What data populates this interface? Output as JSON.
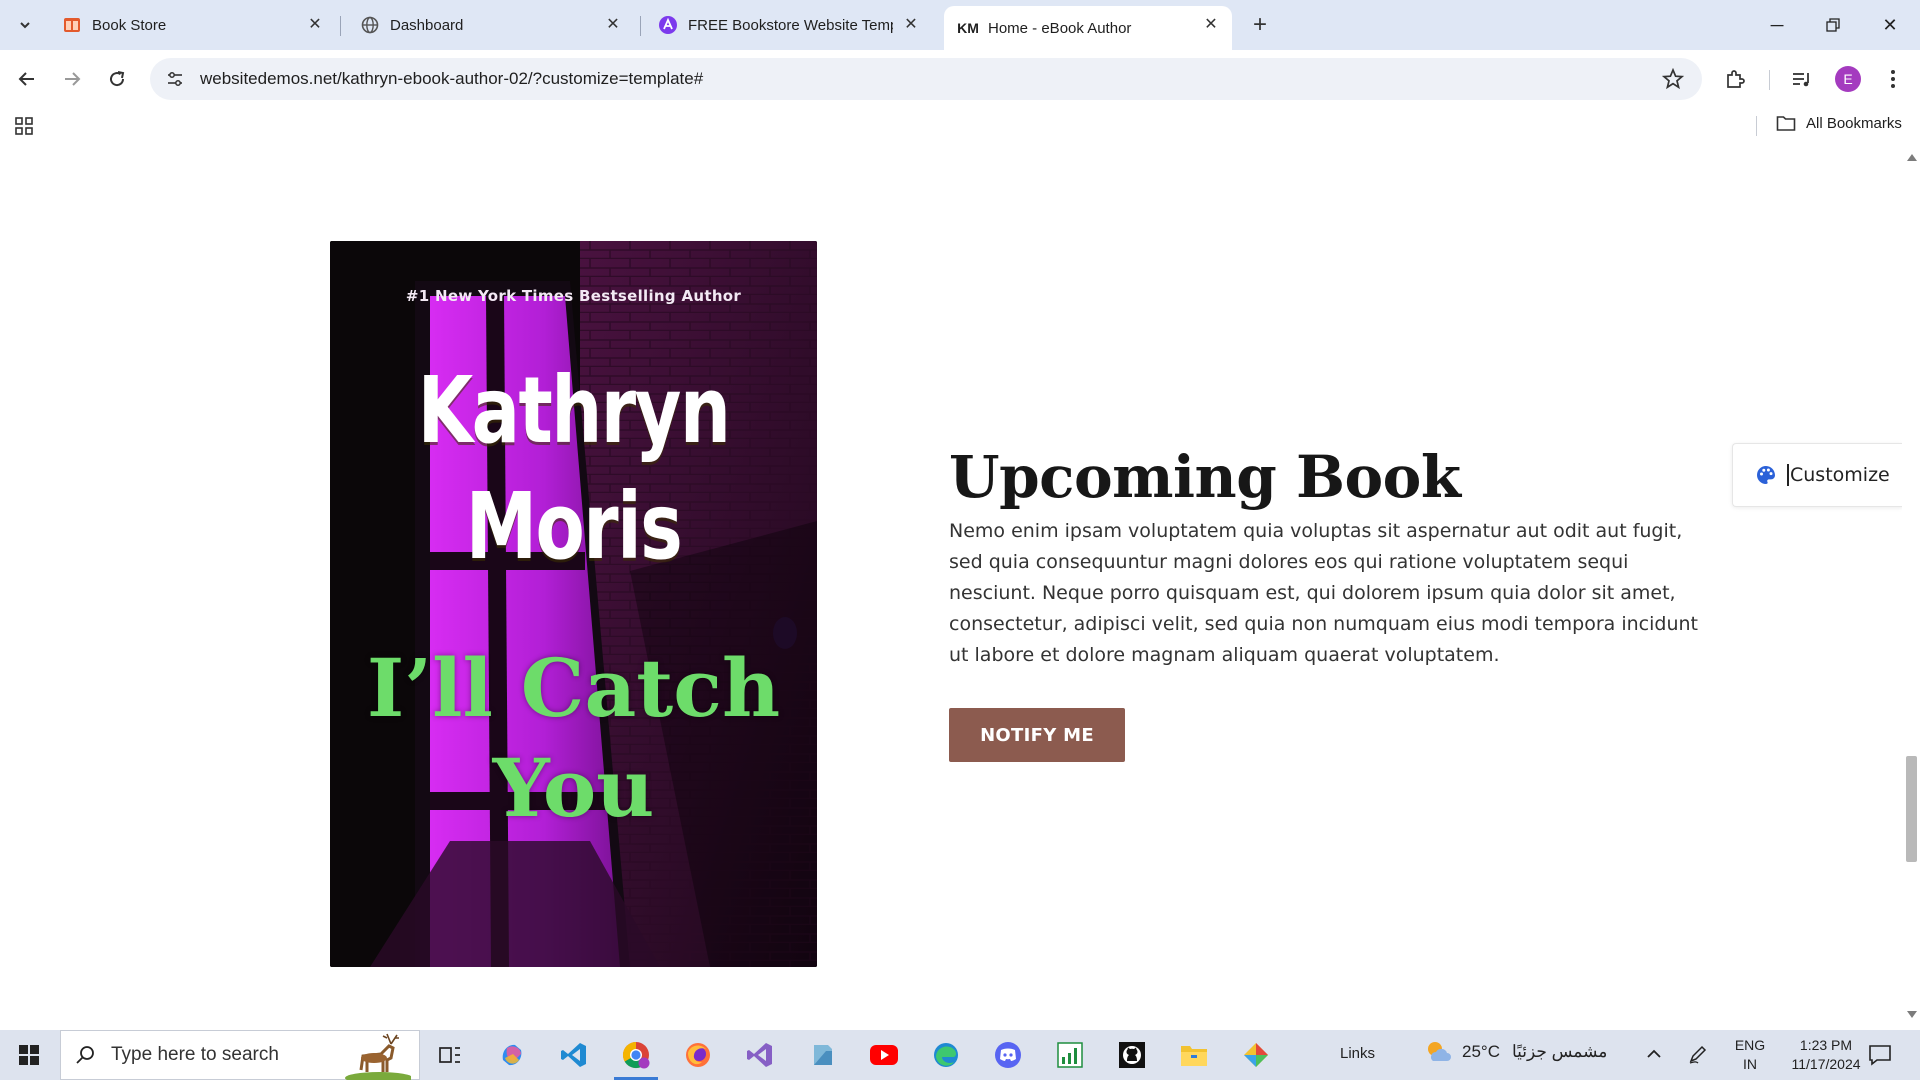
{
  "browser": {
    "tabs": [
      {
        "title": "Book Store",
        "favicon": "bookstore-icon",
        "active": false
      },
      {
        "title": "Dashboard",
        "favicon": "globe-icon",
        "active": false
      },
      {
        "title": "FREE Bookstore Website Templ",
        "favicon": "astra-icon",
        "active": false
      },
      {
        "title": "Home - eBook Author",
        "favicon": "km-logo",
        "active": true
      }
    ],
    "favicon_text_km": "KM",
    "url": "websitedemos.net/kathryn-ebook-author-02/?customize=template#",
    "avatar_letter": "E",
    "bookmarks_label": "All Bookmarks"
  },
  "cover": {
    "tagline": "#1 New York Times Bestselling Author",
    "author_line1": "Kathryn",
    "author_line2": "Moris",
    "title_line1": "I’ll Catch",
    "title_line2": "You",
    "colors": {
      "background": "#0b0709",
      "purple": "#b21fd6",
      "title_green": "#6ddc6a"
    }
  },
  "section": {
    "heading": "Upcoming Book",
    "description": "Nemo enim ipsam voluptatem quia voluptas sit aspernatur aut odit aut fugit, sed quia consequuntur magni dolores eos qui ratione voluptatem sequi nesciunt. Neque porro quisquam est, qui dolorem ipsum quia dolor sit amet, consectetur, adipisci velit, sed quia non numquam eius modi tempora incidunt ut labore et dolore magnam aliquam quaerat voluptatem.",
    "button_label": "NOTIFY ME",
    "button_color": "#8c5b4f"
  },
  "customize": {
    "label": "Customize",
    "icon": "palette-icon"
  },
  "taskbar": {
    "search_placeholder": "Type here to search",
    "links_label": "Links",
    "temperature": "25°C",
    "weather_text": "مشمس جزئيًا",
    "lang_line1": "ENG",
    "lang_line2": "IN",
    "time": "1:23 PM",
    "date": "11/17/2024"
  }
}
